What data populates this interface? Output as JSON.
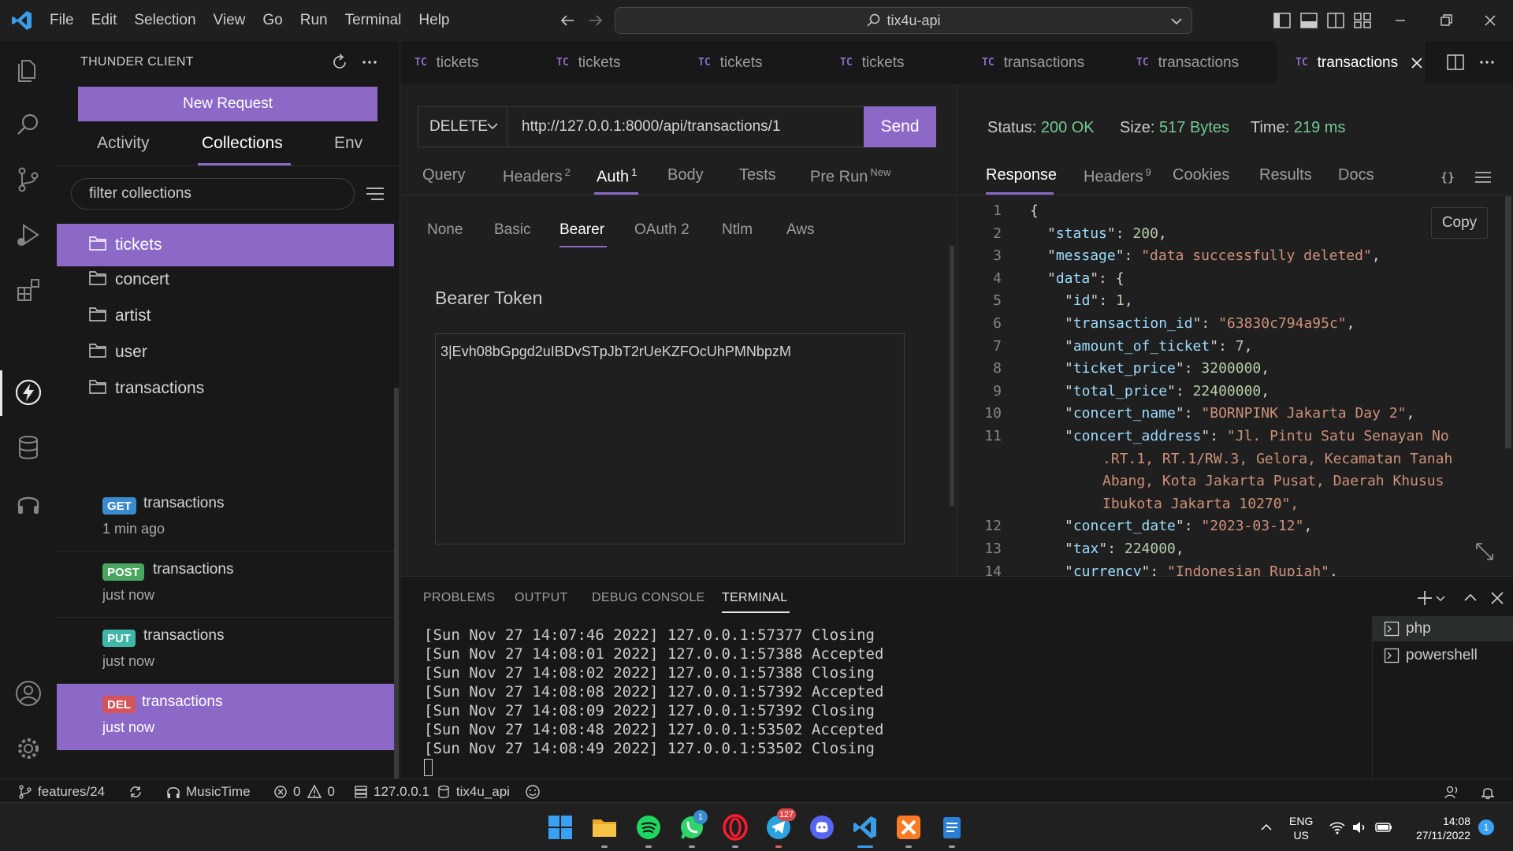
{
  "titlebar": {
    "menu": [
      "File",
      "Edit",
      "Selection",
      "View",
      "Go",
      "Run",
      "Terminal",
      "Help"
    ],
    "search_text": "tix4u-api"
  },
  "sidebar": {
    "title": "THUNDER CLIENT",
    "new_request": "New Request",
    "tabs": [
      "Activity",
      "Collections",
      "Env"
    ],
    "filter_placeholder": "filter collections",
    "collections": [
      "tickets",
      "concert",
      "artist",
      "user",
      "transactions"
    ],
    "requests": [
      {
        "method": "GET",
        "name": "transactions",
        "time": "1 min ago",
        "color": "#3a8ccf"
      },
      {
        "method": "POST",
        "name": "transactions",
        "time": "just now",
        "color": "#49a65e"
      },
      {
        "method": "PUT",
        "name": "transactions",
        "time": "just now",
        "color": "#3fb7a6"
      },
      {
        "method": "DEL",
        "name": "transactions",
        "time": "just now",
        "color": "#d5545a"
      }
    ]
  },
  "tabs": [
    "tickets",
    "tickets",
    "tickets",
    "tickets",
    "transactions",
    "transactions",
    "transactions"
  ],
  "request": {
    "method": "DELETE",
    "url": "http://127.0.0.1:8000/api/transactions/1",
    "send": "Send",
    "tabs": [
      {
        "label": "Query",
        "count": ""
      },
      {
        "label": "Headers",
        "count": "2"
      },
      {
        "label": "Auth",
        "count": "1"
      },
      {
        "label": "Body",
        "count": ""
      },
      {
        "label": "Tests",
        "count": ""
      },
      {
        "label": "Pre Run",
        "count": "New"
      }
    ],
    "auth_tabs": [
      "None",
      "Basic",
      "Bearer",
      "OAuth 2",
      "Ntlm",
      "Aws"
    ],
    "bearer_label": "Bearer Token",
    "token": "3|Evh08bGpgd2uIBDvSTpJbT2rUeKZFOcUhPMNbpzM"
  },
  "response": {
    "status_label": "Status:",
    "status_value": "200 OK",
    "size_label": "Size:",
    "size_value": "517 Bytes",
    "time_label": "Time:",
    "time_value": "219 ms",
    "tabs": [
      {
        "label": "Response",
        "count": ""
      },
      {
        "label": "Headers",
        "count": "9"
      },
      {
        "label": "Cookies",
        "count": ""
      },
      {
        "label": "Results",
        "count": ""
      },
      {
        "label": "Docs",
        "count": ""
      }
    ],
    "copy": "Copy",
    "json_lines": [
      {
        "n": "1",
        "indent": 0,
        "key": "",
        "val": "{",
        "type": "p",
        "comma": false
      },
      {
        "n": "2",
        "indent": 1,
        "key": "status",
        "val": "200",
        "type": "n",
        "comma": true
      },
      {
        "n": "3",
        "indent": 1,
        "key": "message",
        "val": "\"data successfully deleted\"",
        "type": "s",
        "comma": true
      },
      {
        "n": "4",
        "indent": 1,
        "key": "data",
        "val": "{",
        "type": "p",
        "comma": false
      },
      {
        "n": "5",
        "indent": 2,
        "key": "id",
        "val": "1",
        "type": "n",
        "comma": true
      },
      {
        "n": "6",
        "indent": 2,
        "key": "transaction_id",
        "val": "\"63830c794a95c\"",
        "type": "s",
        "comma": true
      },
      {
        "n": "7",
        "indent": 2,
        "key": "amount_of_ticket",
        "val": "7",
        "type": "n",
        "comma": true
      },
      {
        "n": "8",
        "indent": 2,
        "key": "ticket_price",
        "val": "3200000",
        "type": "n",
        "comma": true
      },
      {
        "n": "9",
        "indent": 2,
        "key": "total_price",
        "val": "22400000",
        "type": "n",
        "comma": true
      },
      {
        "n": "10",
        "indent": 2,
        "key": "concert_name",
        "val": "\"BORNPINK Jakarta Day 2\"",
        "type": "s",
        "comma": true
      },
      {
        "n": "11",
        "indent": 2,
        "key": "concert_address",
        "val": "\"Jl. Pintu Satu Senayan No",
        "type": "s",
        "comma": false
      },
      {
        "n": "12",
        "indent": 2,
        "key": "concert_date",
        "val": "\"2023-03-12\"",
        "type": "s",
        "comma": true
      },
      {
        "n": "13",
        "indent": 2,
        "key": "tax",
        "val": "224000",
        "type": "n",
        "comma": true
      },
      {
        "n": "14",
        "indent": 2,
        "key": "currency",
        "val": "\"Indonesian Rupiah\"",
        "type": "s",
        "comma": true
      }
    ],
    "wrap_lines": [
      ".RT.1, RT.1/RW.3, Gelora, Kecamatan Tanah",
      "Abang, Kota Jakarta Pusat, Daerah Khusus",
      "Ibukota Jakarta 10270\","
    ]
  },
  "panel": {
    "tabs": [
      "PROBLEMS",
      "OUTPUT",
      "DEBUG CONSOLE",
      "TERMINAL"
    ],
    "terminal_lines": [
      "[Sun Nov 27 14:07:46 2022] 127.0.0.1:57377 Closing",
      "[Sun Nov 27 14:08:01 2022] 127.0.0.1:57388 Accepted",
      "[Sun Nov 27 14:08:02 2022] 127.0.0.1:57388 Closing",
      "[Sun Nov 27 14:08:08 2022] 127.0.0.1:57392 Accepted",
      "[Sun Nov 27 14:08:09 2022] 127.0.0.1:57392 Closing",
      "[Sun Nov 27 14:08:48 2022] 127.0.0.1:53502 Accepted",
      "[Sun Nov 27 14:08:49 2022] 127.0.0.1:53502 Closing"
    ],
    "terminals": [
      "php",
      "powershell"
    ]
  },
  "statusbar": {
    "branch": "features/24",
    "music": "MusicTime",
    "errors": "0",
    "warnings": "0",
    "db_host": "127.0.0.1",
    "db_name": "tix4u_api"
  },
  "taskbar": {
    "lang": "ENG",
    "region": "US",
    "time": "14:08",
    "date": "27/11/2022",
    "whatsapp_badge": "1",
    "telegram_badge": "127",
    "notif_badge": "1"
  },
  "colors": {
    "accent": "#8c69c7",
    "status_ok": "#73c991"
  }
}
